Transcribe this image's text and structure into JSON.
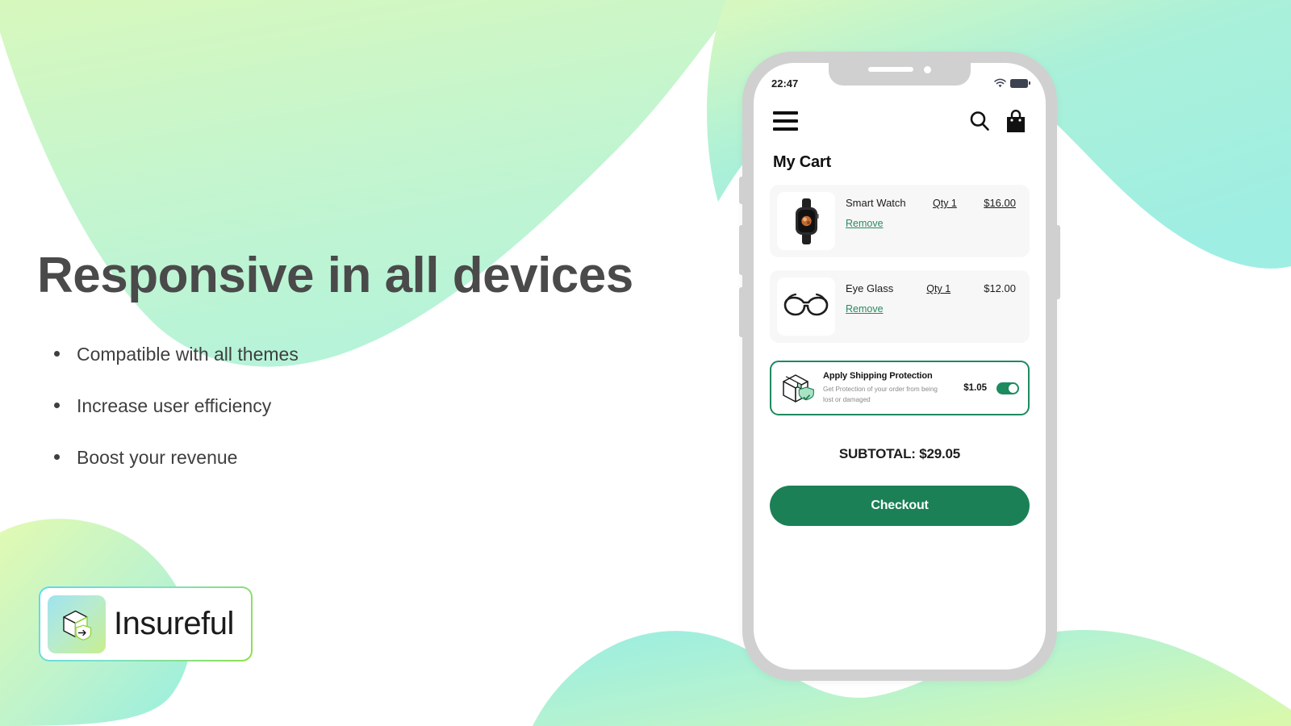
{
  "marketing": {
    "headline": "Responsive in all devices",
    "bullets": [
      {
        "label": "Compatible with all themes"
      },
      {
        "label": "Increase user efficiency"
      },
      {
        "label": "Boost your revenue"
      }
    ],
    "logo": {
      "name": "Insureful",
      "icon": "box-shield-arrow-icon"
    }
  },
  "phone": {
    "status": {
      "time": "22:47",
      "wifi_icon": "wifi-icon",
      "battery_icon": "battery-full-icon"
    },
    "app": {
      "header": {
        "menu_icon": "hamburger-menu-icon",
        "search_icon": "search-icon",
        "bag_icon": "shopping-bag-icon"
      },
      "page_title": "My Cart",
      "items": [
        {
          "name": "Smart Watch",
          "qty": "Qty 1",
          "price": "$16.00",
          "price_underline": true,
          "remove": "Remove",
          "thumb_icon": "smart-watch-image"
        },
        {
          "name": "Eye Glass",
          "qty": "Qty 1",
          "price": "$12.00",
          "price_underline": false,
          "remove": "Remove",
          "thumb_icon": "eye-glass-image"
        }
      ],
      "protection": {
        "title": "Apply Shipping Protection",
        "subtitle": "Get Protection of your order from being lost or damaged",
        "price": "$1.05",
        "icon": "package-shield-icon",
        "toggle_on": true
      },
      "subtotal": "SUBTOTAL: $29.05",
      "checkout_label": "Checkout"
    }
  },
  "colors": {
    "brand_green": "#1b8056",
    "link_green": "#2a8a5f",
    "blob_green_top": "#d2f7c4",
    "blob_teal": "#a8efe0",
    "heading_gray": "#4a4a4a",
    "phone_frame": "#d0d0d0"
  }
}
